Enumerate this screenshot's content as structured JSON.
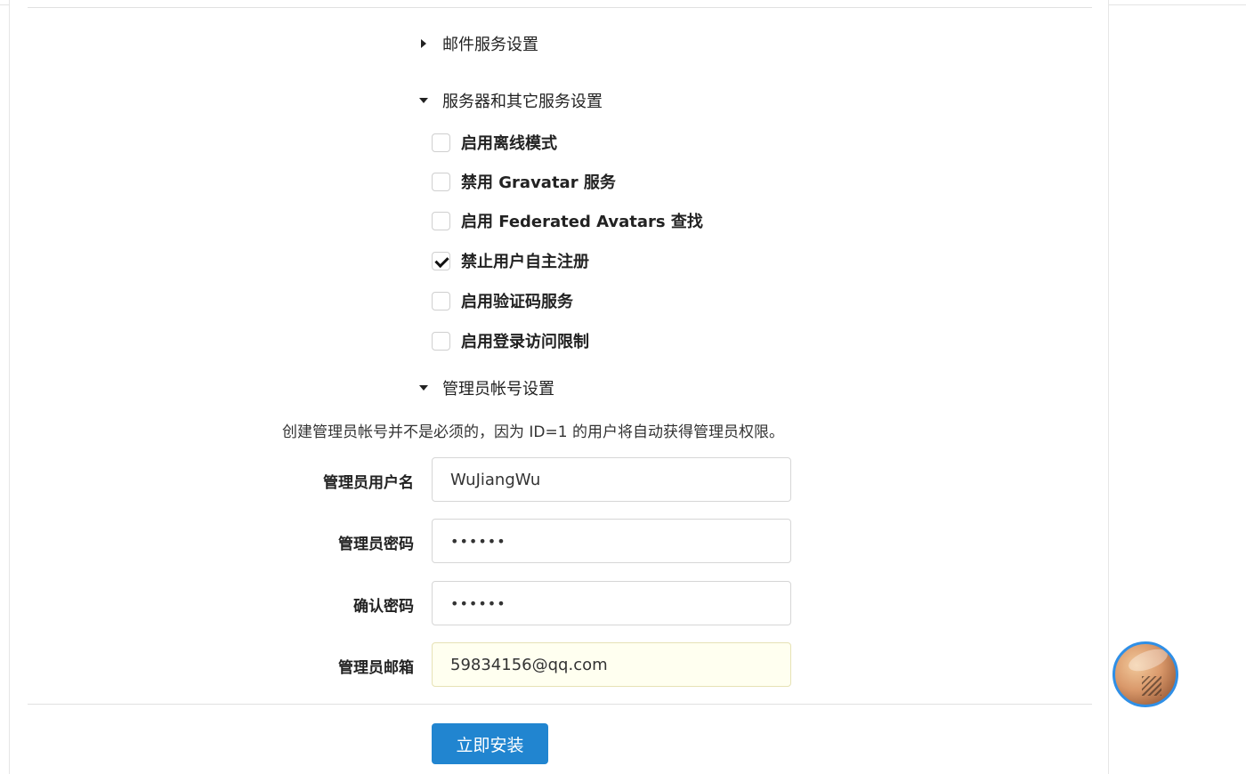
{
  "sections": {
    "mail": {
      "title": "邮件服务设置",
      "expanded": false
    },
    "server": {
      "title": "服务器和其它服务设置",
      "expanded": true,
      "options": [
        {
          "label": "启用离线模式",
          "checked": false
        },
        {
          "label": "禁用 Gravatar 服务",
          "checked": false
        },
        {
          "label": "启用 Federated Avatars 查找",
          "checked": false
        },
        {
          "label": "禁止用户自主注册",
          "checked": true
        },
        {
          "label": "启用验证码服务",
          "checked": false
        },
        {
          "label": "启用登录访问限制",
          "checked": false
        }
      ]
    },
    "admin": {
      "title": "管理员帐号设置",
      "expanded": true,
      "note": "创建管理员帐号并不是必须的，因为 ID=1 的用户将自动获得管理员权限。",
      "fields": {
        "username": {
          "label": "管理员用户名",
          "value": "WuJiangWu"
        },
        "password": {
          "label": "管理员密码",
          "value": "••••••"
        },
        "confirm": {
          "label": "确认密码",
          "value": "••••••"
        },
        "email": {
          "label": "管理员邮箱",
          "value": "59834156@qq.com"
        }
      }
    }
  },
  "install_button": "立即安装",
  "colors": {
    "primary": "#2185d0",
    "avatar_ring": "#2f8fe6",
    "autofill_bg": "#fffff0"
  }
}
